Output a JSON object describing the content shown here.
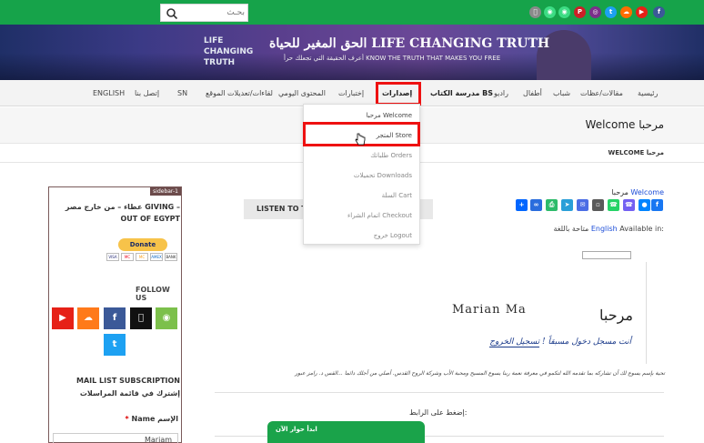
{
  "topbar": {
    "search_placeholder": "بحـث",
    "social_icons": [
      "facebook-icon",
      "youtube-icon",
      "soundcloud-icon",
      "twitter-icon",
      "instagram-icon",
      "pinterest-icon",
      "android-icon",
      "android-icon",
      "apple-icon"
    ],
    "colors": {
      "bar": "#16a34a"
    }
  },
  "banner": {
    "title": "الحق المغير للحياة LIFE CHANGING TRUTH",
    "subtitle": "أعرف الحقيقة التي تجعلك حرأ KNOW THE TRUTH THAT MAKES YOU FREE",
    "logo_text": "LIFE CHANGING TRUTH"
  },
  "nav": {
    "items": [
      "رئيسية",
      "مقالات/عظات",
      "شباب",
      "أطفال",
      "راديو",
      "مدرسة الكتاب BS",
      "إصدارات",
      "إختبارات",
      "المحتوى اليومي",
      "لقاءات/تعديلات الموقع",
      "SN",
      "إتصل بنا",
      "ENGLISH"
    ]
  },
  "dropdown": {
    "items": [
      "مرحبا Welcome",
      "المتجر Store",
      "طلباتك Orders",
      "تحميلات Downloads",
      "السلة Cart",
      "اتمام الشراء Checkout",
      "خروج Logout"
    ]
  },
  "page": {
    "title": "Welcome مرحبا",
    "breadcrumb": "WELCOME مرحبا",
    "listen_label": "LISTEN TO T",
    "welcome_line_en": "Welcome",
    "welcome_line_ar": "مرحبا",
    "available_label": "Available in:",
    "available_lang": "English",
    "available_ar": "متاحة باللغة",
    "big_heading": "مرحبا",
    "ghost_text": "Marian Ma",
    "promo_plain": "أنت مسجل دخول مسبقاً !",
    "promo_link": "تسجيل الخروج",
    "long_text": "تحية بإسم يسوع لك أن تشاركه بما تقدمه الله لتكمو في معرفة نعمة ربنا يسوع المسيح ومحبة الأب وشركة الروح القدس. أصلي من أجلك دائما ...القس د. رامز عبور",
    "click_link": "إضغط على الرابط:",
    "chat_label": "ابدأ حوار الآن"
  },
  "sidebar": {
    "tag": "sidebar-1",
    "give_text": "عطاء – من خارج مصر GIVING – OUT OF EGYPT",
    "donate_label": "Donate",
    "cards": [
      "VISA",
      "MC",
      "MC",
      "AMEX",
      "BANK"
    ],
    "follow_label": "FOLLOW US",
    "follow_icons": [
      "youtube-icon",
      "soundcloud-icon",
      "facebook-icon",
      "apple-icon",
      "android-icon",
      "twitter-icon"
    ],
    "mail_text": "MAIL LIST SUBSCRIPTION إشترك في قائمة المراسلات",
    "name_label": "Name الإسم",
    "required_mark": "*",
    "name_value": "Mariam"
  },
  "share_icons": [
    "facebook-icon",
    "messenger-icon",
    "viber-icon",
    "whatsapp-icon",
    "sms-icon",
    "email-icon",
    "telegram-icon",
    "print-icon",
    "copy-link-icon",
    "share-icon"
  ]
}
